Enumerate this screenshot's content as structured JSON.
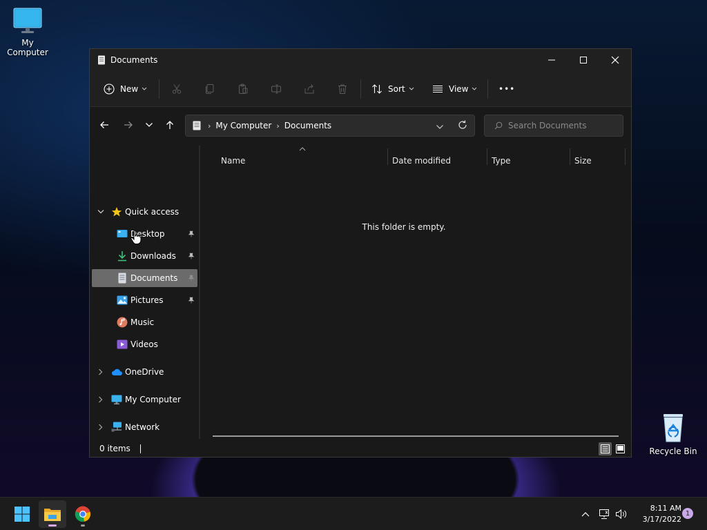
{
  "desktop": {
    "icons": [
      {
        "label": "My Computer"
      },
      {
        "label": "Recycle Bin"
      }
    ]
  },
  "window": {
    "title": "Documents",
    "controls": {
      "minimize": "minimize-icon",
      "maximize": "maximize-icon",
      "close": "close-icon"
    }
  },
  "toolbar": {
    "new_label": "New",
    "sort_label": "Sort",
    "view_label": "View",
    "more_label": "•••",
    "disabled_actions": [
      "cut-icon",
      "copy-icon",
      "paste-icon",
      "rename-icon",
      "share-icon",
      "delete-icon"
    ]
  },
  "address": {
    "crumbs": [
      "My Computer",
      "Documents"
    ]
  },
  "search": {
    "placeholder": "Search Documents"
  },
  "navpane": {
    "quick_access": "Quick access",
    "items": [
      {
        "label": "Desktop",
        "pinned": true
      },
      {
        "label": "Downloads",
        "pinned": true
      },
      {
        "label": "Documents",
        "pinned": true,
        "selected": true
      },
      {
        "label": "Pictures",
        "pinned": true
      },
      {
        "label": "Music",
        "pinned": false
      },
      {
        "label": "Videos",
        "pinned": false
      }
    ],
    "roots": [
      {
        "label": "OneDrive"
      },
      {
        "label": "My Computer"
      },
      {
        "label": "Network"
      }
    ]
  },
  "content": {
    "columns": [
      "Name",
      "Date modified",
      "Type",
      "Size"
    ],
    "empty_message": "This folder is empty."
  },
  "status": {
    "item_count": "0 items"
  },
  "taskbar": {
    "time": "8:11 AM",
    "date": "3/17/2022",
    "notification_count": "1"
  },
  "colors": {
    "accent": "#0078d4",
    "selected_nav": "#6b6b6b",
    "window_bg": "#191919",
    "bar_bg": "#202020"
  }
}
